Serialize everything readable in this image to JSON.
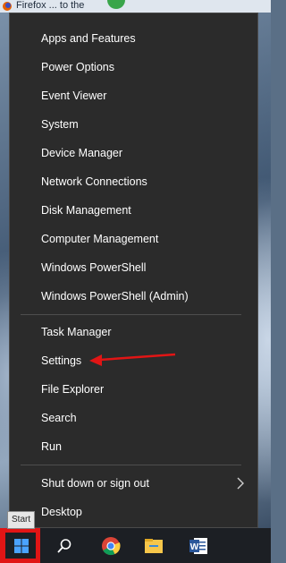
{
  "top_strip": {
    "text": "Firefox ... to the"
  },
  "menu": {
    "group1": [
      "Apps and Features",
      "Power Options",
      "Event Viewer",
      "System",
      "Device Manager",
      "Network Connections",
      "Disk Management",
      "Computer Management",
      "Windows PowerShell",
      "Windows PowerShell (Admin)"
    ],
    "group2": [
      "Task Manager",
      "Settings",
      "File Explorer",
      "Search",
      "Run"
    ],
    "shutdown": "Shut down or sign out",
    "desktop": "Desktop"
  },
  "tooltip": {
    "start": "Start"
  },
  "icons": {
    "start": "windows-logo-icon",
    "search": "search-icon",
    "chrome": "chrome-icon",
    "explorer": "file-explorer-icon",
    "word": "word-icon",
    "submenu": "chevron-right-icon"
  },
  "colors": {
    "menu_bg": "#2b2b2b",
    "highlight_red": "#e11515",
    "accent_blue": "#0078d7"
  }
}
